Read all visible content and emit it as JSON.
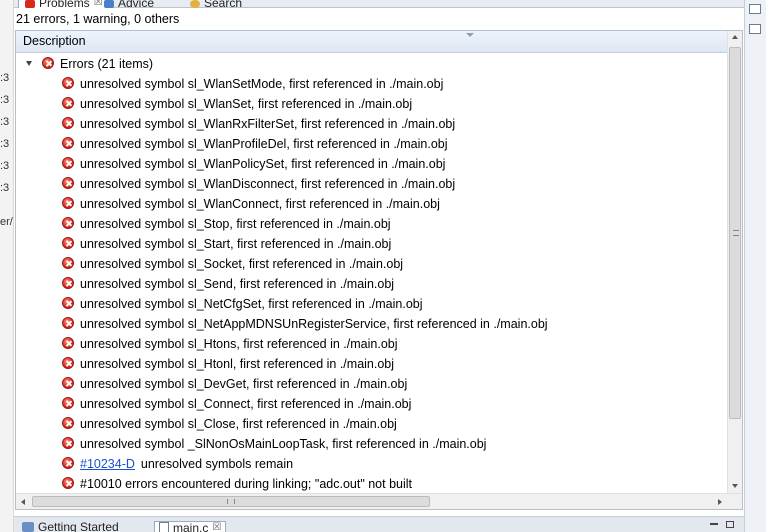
{
  "top_tabs": [
    {
      "label": "Problems",
      "close": "☒"
    },
    {
      "label": "Advice"
    },
    {
      "label": "Search"
    }
  ],
  "summary": "21 errors, 1 warning, 0 others",
  "column_header": "Description",
  "group": {
    "label": "Errors (21 items)",
    "expanded": true
  },
  "problems": [
    {
      "text": "unresolved symbol sl_WlanSetMode, first referenced in ./main.obj"
    },
    {
      "text": "unresolved symbol sl_WlanSet, first referenced in ./main.obj"
    },
    {
      "text": "unresolved symbol sl_WlanRxFilterSet, first referenced in ./main.obj"
    },
    {
      "text": "unresolved symbol sl_WlanProfileDel, first referenced in ./main.obj"
    },
    {
      "text": "unresolved symbol sl_WlanPolicySet, first referenced in ./main.obj"
    },
    {
      "text": "unresolved symbol sl_WlanDisconnect, first referenced in ./main.obj"
    },
    {
      "text": "unresolved symbol sl_WlanConnect, first referenced in ./main.obj"
    },
    {
      "text": "unresolved symbol sl_Stop, first referenced in ./main.obj"
    },
    {
      "text": "unresolved symbol sl_Start, first referenced in ./main.obj"
    },
    {
      "text": "unresolved symbol sl_Socket, first referenced in ./main.obj"
    },
    {
      "text": "unresolved symbol sl_Send, first referenced in ./main.obj"
    },
    {
      "text": "unresolved symbol sl_NetCfgSet, first referenced in ./main.obj"
    },
    {
      "text": "unresolved symbol sl_NetAppMDNSUnRegisterService, first referenced in ./main.obj"
    },
    {
      "text": "unresolved symbol sl_Htons, first referenced in ./main.obj"
    },
    {
      "text": "unresolved symbol sl_Htonl, first referenced in ./main.obj"
    },
    {
      "text": "unresolved symbol sl_DevGet, first referenced in ./main.obj"
    },
    {
      "text": "unresolved symbol sl_Connect, first referenced in ./main.obj"
    },
    {
      "text": "unresolved symbol sl_Close, first referenced in ./main.obj"
    },
    {
      "text": "unresolved symbol _SlNonOsMainLoopTask, first referenced in ./main.obj"
    },
    {
      "link": "#10234-D",
      "text": "unresolved symbols remain"
    },
    {
      "text": "#10010 errors encountered during linking; \"adc.out\" not built"
    }
  ],
  "bottom_tabs": [
    {
      "label": "Getting Started"
    },
    {
      "label": "main.c",
      "close": "☒"
    }
  ],
  "left_fragments": [
    ":3",
    ":3",
    ":3",
    ":3",
    ":3",
    ":3",
    "er/"
  ],
  "colors": {
    "error": "#d8281c",
    "link": "#1a4fd8",
    "header": "#dde7f3"
  },
  "icons": {
    "error": "error-icon",
    "twisty": "expand-triangle-icon"
  }
}
